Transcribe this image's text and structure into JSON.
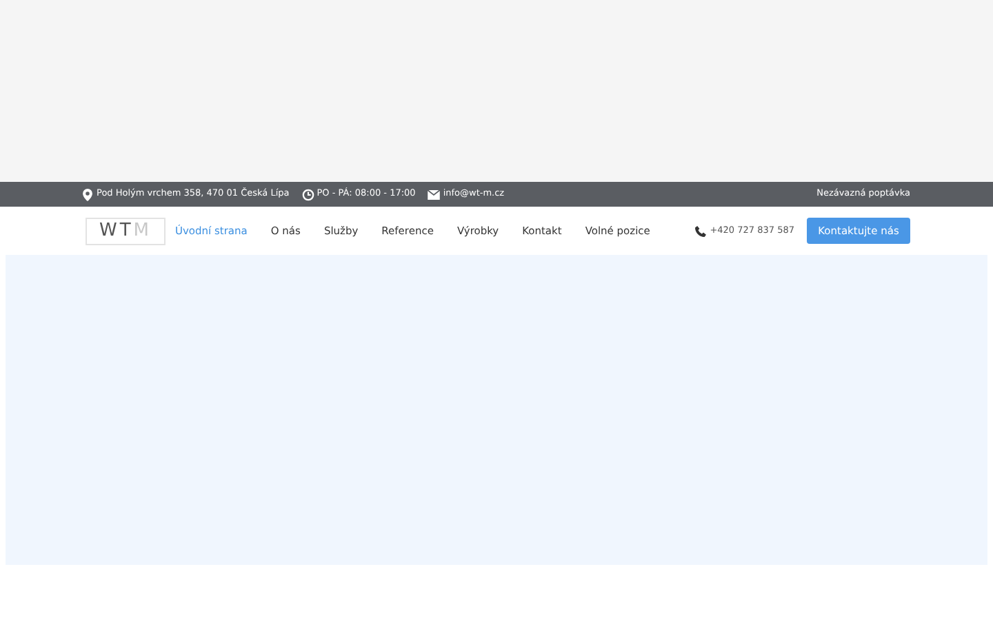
{
  "top_bar": {
    "address": "Pod Holým vrchem 358, 470 01 Česká Lípa",
    "hours": "PO - PÁ: 08:00 - 17:00",
    "email": "info@wt-m.cz",
    "quote_link": "Nezávazná poptávka"
  },
  "logo": {
    "main": "WT",
    "accent": "M"
  },
  "nav": [
    {
      "label": "Úvodní strana",
      "selected": true
    },
    {
      "label": "O nás",
      "selected": false
    },
    {
      "label": "Služby",
      "selected": false
    },
    {
      "label": "Reference",
      "selected": false
    },
    {
      "label": "Výrobky",
      "selected": false
    },
    {
      "label": "Kontakt",
      "selected": false
    },
    {
      "label": "Volné pozice",
      "selected": false
    }
  ],
  "phone": "+420 727 837 587",
  "contact_button": "Kontaktujte nás"
}
